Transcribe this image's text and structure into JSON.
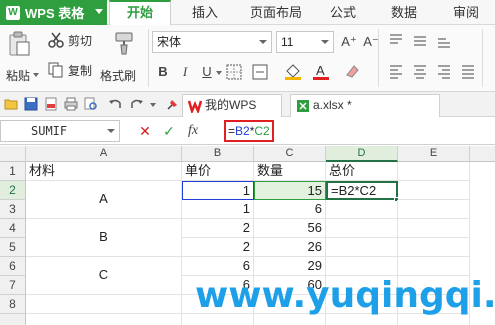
{
  "app": {
    "name": "WPS 表格",
    "logo_letter": "W"
  },
  "menu": {
    "tabs": [
      "开始",
      "插入",
      "页面布局",
      "公式",
      "数据",
      "审阅"
    ],
    "active_index": 0
  },
  "ribbon": {
    "cut_label": "剪切",
    "paste_label": "粘贴",
    "copy_label": "复制",
    "format_painter_label": "格式刷",
    "font_name": "宋体",
    "font_size": "11",
    "bold": "B",
    "italic": "I",
    "underline": "U",
    "grow_font": "A⁺",
    "shrink_font": "A⁻"
  },
  "doc_tabs": [
    {
      "label": "我的WPS",
      "icon": "wps-logo-icon"
    },
    {
      "label": "a.xlsx *",
      "icon": "spreadsheet-file-icon"
    }
  ],
  "formula_bar": {
    "name_box": "SUMIF",
    "fx": "fx",
    "formula_prefix": "=",
    "formula_ref1": "B2",
    "formula_op": "*",
    "formula_ref2": "C2"
  },
  "grid": {
    "columns": [
      "A",
      "B",
      "C",
      "D",
      "E"
    ],
    "selected_column": "D",
    "rows": [
      "1",
      "2",
      "3",
      "4",
      "5",
      "6",
      "7",
      "8"
    ],
    "selected_row": "2",
    "header": {
      "A": "材料",
      "B": "单价",
      "C": "数量",
      "D": "总价"
    },
    "materials": [
      "A",
      "B",
      "C"
    ],
    "unit_price": [
      "1",
      "1",
      "2",
      "2",
      "6",
      "6"
    ],
    "quantity": [
      "15",
      "6",
      "56",
      "26",
      "29",
      "60"
    ],
    "active_cell_text": "=B2*C2"
  },
  "watermark": "www.yuqingqi.com",
  "colors": {
    "accent": "#2e9e3e",
    "ref_blue": "#1f3fd8",
    "ref_green": "#2e9e3e",
    "highlight": "#e02020",
    "watermark": "#1ea0e8"
  }
}
